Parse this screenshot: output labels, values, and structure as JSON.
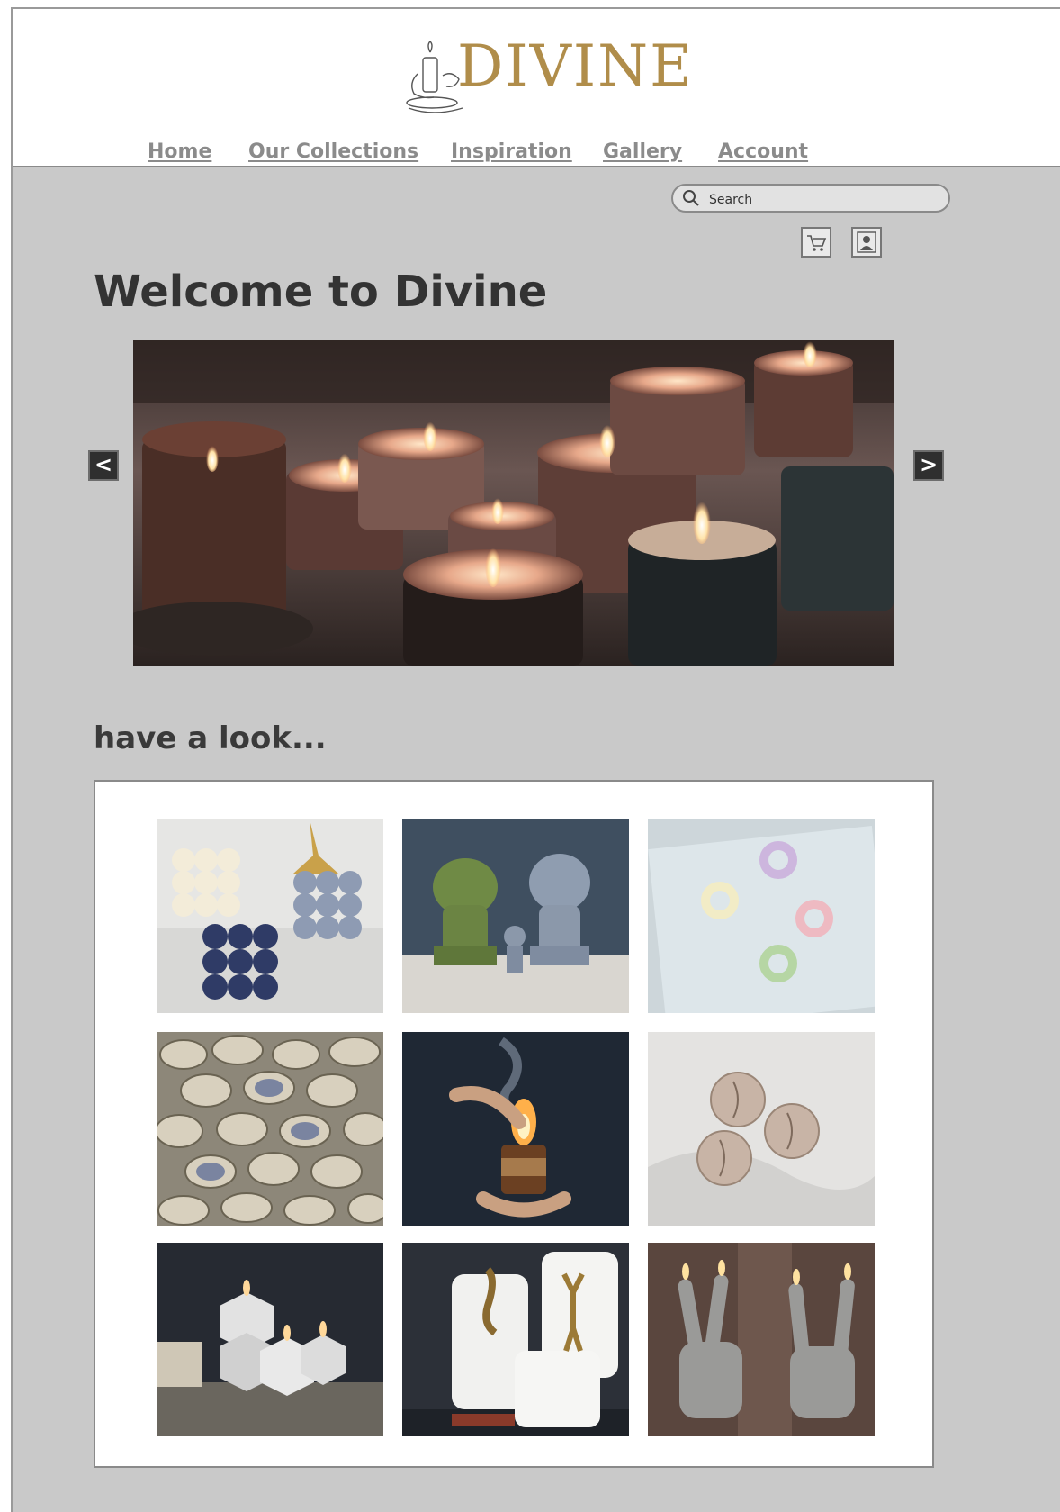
{
  "brand": {
    "logo_text": "DIVINE"
  },
  "nav": {
    "items": [
      {
        "label": "Home"
      },
      {
        "label": "Our Collections"
      },
      {
        "label": "Inspiration"
      },
      {
        "label": "Gallery"
      },
      {
        "label": "Account"
      }
    ]
  },
  "search": {
    "placeholder": "Search"
  },
  "header_icons": [
    "cart-icon",
    "account-icon"
  ],
  "hero": {
    "title": "Welcome to Divine",
    "prev_label": "<",
    "next_label": ">"
  },
  "gallery": {
    "title": "have a look...",
    "items": [
      "bubble-cube-candles",
      "bust-statue-candles",
      "knot-candles",
      "seashell-candles",
      "lighting-jar-candle",
      "moon-face-candles",
      "geometric-candles",
      "figure-pillar-candles",
      "hand-gesture-candles"
    ]
  },
  "colors": {
    "page_bg": "#c9c9c9",
    "header_bg": "#ffffff",
    "logo_gold": "#b08d4a",
    "nav_text": "#8b8b8b",
    "heading_text": "#333333"
  }
}
